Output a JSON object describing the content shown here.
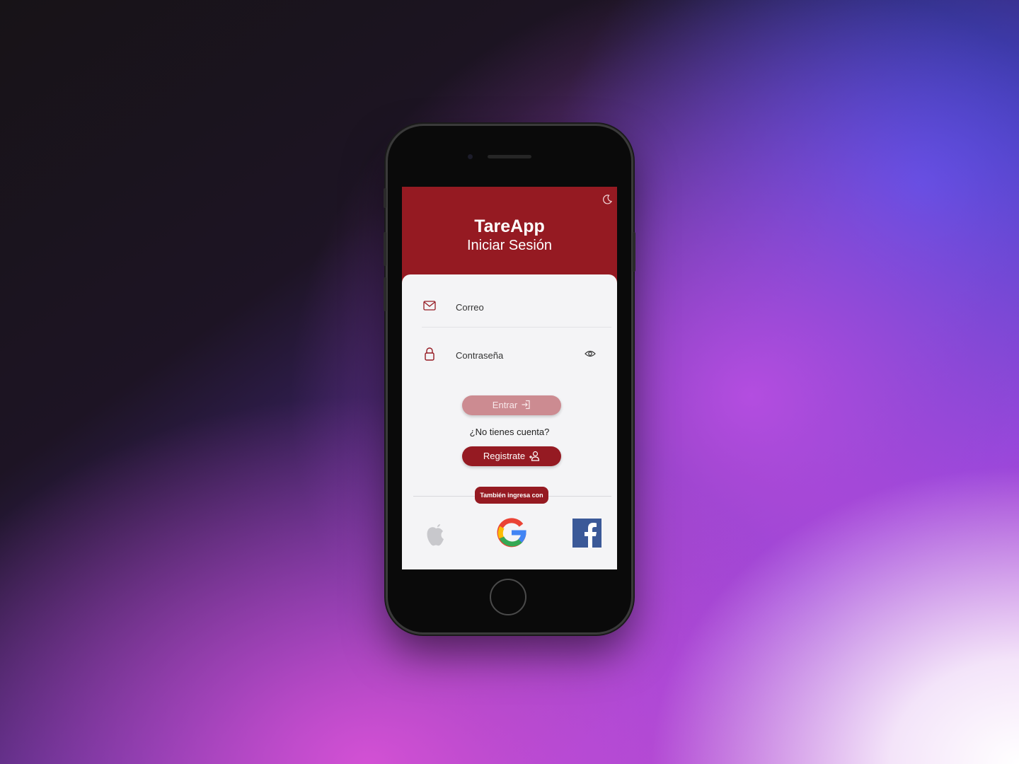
{
  "app": {
    "title": "TareApp",
    "subtitle": "Iniciar Sesión"
  },
  "form": {
    "email_label": "Correo",
    "password_label": "Contraseña",
    "login_button": "Entrar",
    "no_account_text": "¿No tienes cuenta?",
    "register_button": "Registrate"
  },
  "social": {
    "divider_label": "También ingresa con",
    "providers": [
      "apple-icon",
      "google-icon",
      "facebook-icon"
    ]
  },
  "colors": {
    "primary": "#951a22",
    "disabled_button": "#cc8b91",
    "screen_bg": "#f4f4f6"
  },
  "icons": {
    "theme_toggle": "moon-icon",
    "email": "mail-icon",
    "password": "lock-icon",
    "show_password": "eye-icon",
    "login": "login-icon",
    "register": "add-user-icon"
  }
}
